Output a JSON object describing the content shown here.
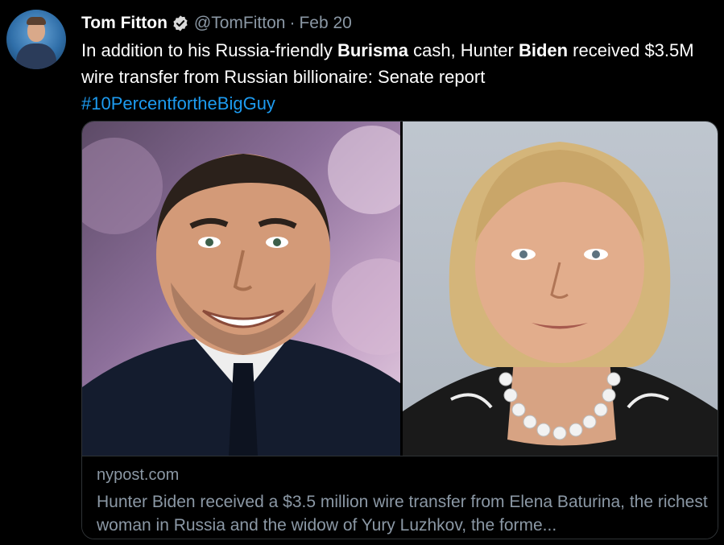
{
  "author": {
    "name": "Tom Fitton",
    "handle": "@TomFitton",
    "separator": "·",
    "date": "Feb 20"
  },
  "tweet": {
    "segments": [
      {
        "text": "In addition to his Russia-friendly ",
        "bold": false
      },
      {
        "text": "Burisma",
        "bold": true
      },
      {
        "text": " cash, Hunter ",
        "bold": false
      },
      {
        "text": "Biden",
        "bold": true
      },
      {
        "text": " received $3.5M wire transfer from Russian billionaire: Senate report",
        "bold": false
      }
    ],
    "hashtag": "#10PercentfortheBigGuy"
  },
  "link_card": {
    "domain": "nypost.com",
    "description": "Hunter Biden received a $3.5 million wire transfer from Elena Baturina, the richest woman in Russia and the widow of Yury Luzhkov, the forme..."
  },
  "colors": {
    "background": "#000000",
    "text": "#ffffff",
    "muted": "#8b98a5",
    "link": "#1d9bf0",
    "verified": "#d9d9d9"
  },
  "icons": {
    "verified": "verified-badge-icon"
  }
}
